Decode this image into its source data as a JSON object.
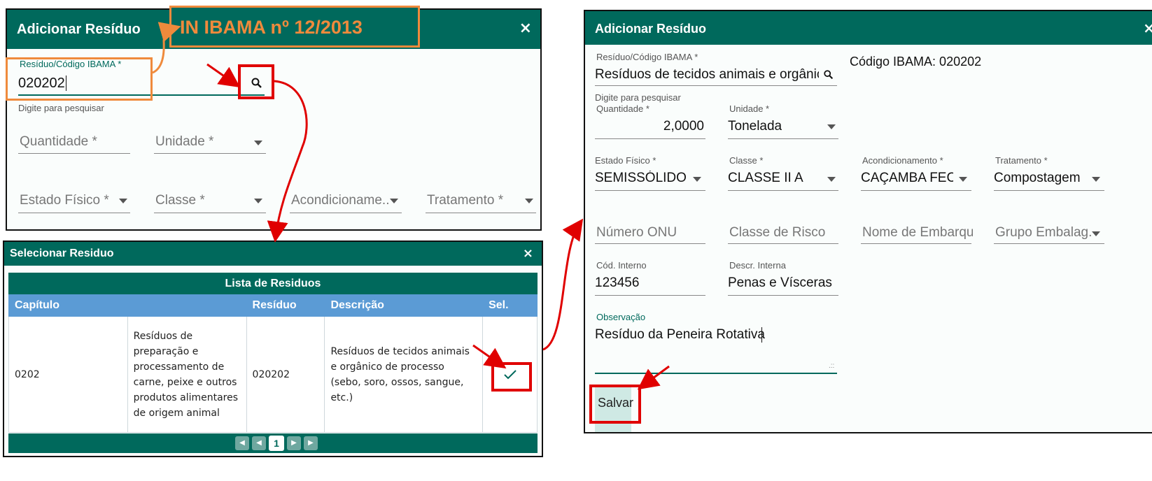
{
  "colors": {
    "header_teal": "#00695c",
    "table_head_blue": "#5b9bd5",
    "annotation_red": "#e00000",
    "annotation_orange": "#ef8a3c"
  },
  "annotation": {
    "callout_text": "IN IBAMA nº 12/2013"
  },
  "dialog_add_left": {
    "title": "Adicionar Resíduo",
    "close_glyph": "×",
    "residuo": {
      "label": "Resíduo/Código IBAMA *",
      "value": "020202",
      "hint": "Digite para pesquisar",
      "icon": "search-icon"
    },
    "quantidade": {
      "placeholder": "Quantidade *"
    },
    "unidade": {
      "placeholder": "Unidade *"
    },
    "estado_fisico": {
      "placeholder": "Estado Físico *"
    },
    "classe": {
      "placeholder": "Classe *"
    },
    "acondicionamento": {
      "placeholder": "Acondicioname..."
    },
    "tratamento": {
      "placeholder": "Tratamento *"
    }
  },
  "dialog_select": {
    "title": "Selecionar Residuo",
    "close_glyph": "×",
    "table_title": "Lista de Residuos",
    "columns": [
      "Capítulo",
      "Resíduo",
      "Descrição",
      "Sel."
    ],
    "row": {
      "capitulo_code": "0202",
      "capitulo_desc": "Resíduos de preparação e processamento de carne, peixe e outros produtos alimentares de origem animal",
      "residuo": "020202",
      "descricao": "Resíduos de tecidos animais e orgânico de processo (sebo, soro, ossos, sangue, etc.)",
      "select_icon": "check-icon"
    },
    "pagination": {
      "current_page": "1"
    }
  },
  "dialog_add_right": {
    "title": "Adicionar Resíduo",
    "close_glyph": "×",
    "residuo": {
      "label": "Resíduo/Código IBAMA *",
      "value": "Resíduos de tecidos animais e orgânico de processo",
      "hint": "Digite para pesquisar",
      "icon": "search-icon"
    },
    "codigo_ibama": "Código IBAMA: 020202",
    "quantidade": {
      "label": "Quantidade *",
      "value": "2,0000"
    },
    "unidade": {
      "label": "Unidade *",
      "value": "Tonelada"
    },
    "estado_fisico": {
      "label": "Estado Físico *",
      "value": "SEMISSÓLIDO"
    },
    "classe": {
      "label": "Classe *",
      "value": "CLASSE II A"
    },
    "acondicionamento": {
      "label": "Acondicionamento *",
      "value": "CAÇAMBA FEC..."
    },
    "tratamento": {
      "label": "Tratamento *",
      "value": "Compostagem"
    },
    "numero_onu": {
      "placeholder": "Número ONU"
    },
    "classe_risco": {
      "placeholder": "Classe de Risco"
    },
    "nome_embarque": {
      "placeholder": "Nome de Embarque"
    },
    "grupo_embalagem": {
      "placeholder": "Grupo Embalag..."
    },
    "cod_interno": {
      "label": "Cód. Interno",
      "value": "123456"
    },
    "descr_interna": {
      "label": "Descr. Interna",
      "value": "Penas e Vísceras"
    },
    "observacao": {
      "label": "Observação",
      "value": "Resíduo da Peneira Rotativa"
    },
    "save_label": "Salvar"
  }
}
